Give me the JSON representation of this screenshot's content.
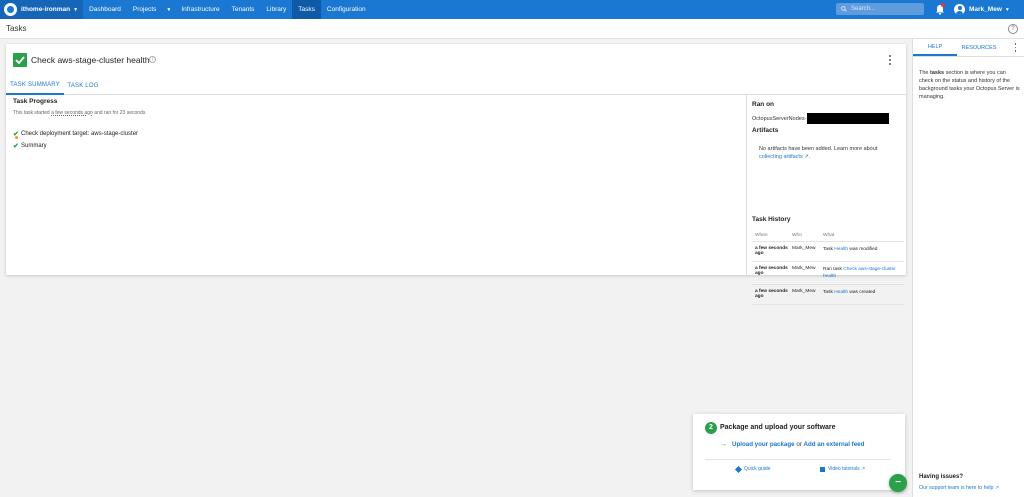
{
  "nav": {
    "space": "ithome-ironman",
    "items": [
      "Dashboard",
      "Projects",
      "Infrastructure",
      "Tenants",
      "Library",
      "Tasks",
      "Configuration"
    ],
    "search_placeholder": "Search...",
    "user": "Mark_Mew",
    "accent": "#1a77d2"
  },
  "page": {
    "title": "Tasks"
  },
  "task": {
    "title": "Check aws-stage-cluster health",
    "tabs": [
      "TASK SUMMARY",
      "TASK LOG"
    ],
    "progress_heading": "Task Progress",
    "progress_sub_prefix": "This task started ",
    "progress_sub_time": "a few seconds ago",
    "progress_sub_suffix": " and ran for 23 seconds",
    "steps": [
      "Check deployment target: aws-stage-cluster",
      "Summary"
    ]
  },
  "side": {
    "ran_on_heading": "Ran on",
    "ran_on_value": "OctopusServerNodes-",
    "artifacts_heading": "Artifacts",
    "artifacts_text": "No artifacts have been added. Learn more about ",
    "artifacts_link": "collecting artifacts",
    "history_heading": "Task History",
    "history_columns": [
      "When",
      "Who",
      "What"
    ],
    "history_rows": [
      {
        "when": "a few seconds ago",
        "who": "Mark_Mew",
        "what_prefix": "Task ",
        "what_link": "Health",
        "what_suffix": " was modified"
      },
      {
        "when": "a few seconds ago",
        "who": "Mark_Mew",
        "what_prefix": "Ran task ",
        "what_link": "Check aws-stage-cluster health",
        "what_suffix": ""
      },
      {
        "when": "a few seconds ago",
        "who": "Mark_Mew",
        "what_prefix": "Task ",
        "what_link": "Health",
        "what_suffix": " was created"
      }
    ]
  },
  "help": {
    "tabs": [
      "HELP",
      "RESOURCES"
    ],
    "text_prefix": "The ",
    "text_bold": "tasks",
    "text_suffix": " section is where you can check on the status and history of the background tasks your Octopus Server is managing.",
    "issues_heading": "Having issues?",
    "issues_link": "Our support team is here to help"
  },
  "onboarding": {
    "step": "2",
    "title": "Package and upload your software",
    "link1": "Upload your package",
    "or": " or ",
    "link2": "Add an external feed",
    "quick_guide": "Quick guide",
    "video": "Video tutorials",
    "fab": "−"
  }
}
